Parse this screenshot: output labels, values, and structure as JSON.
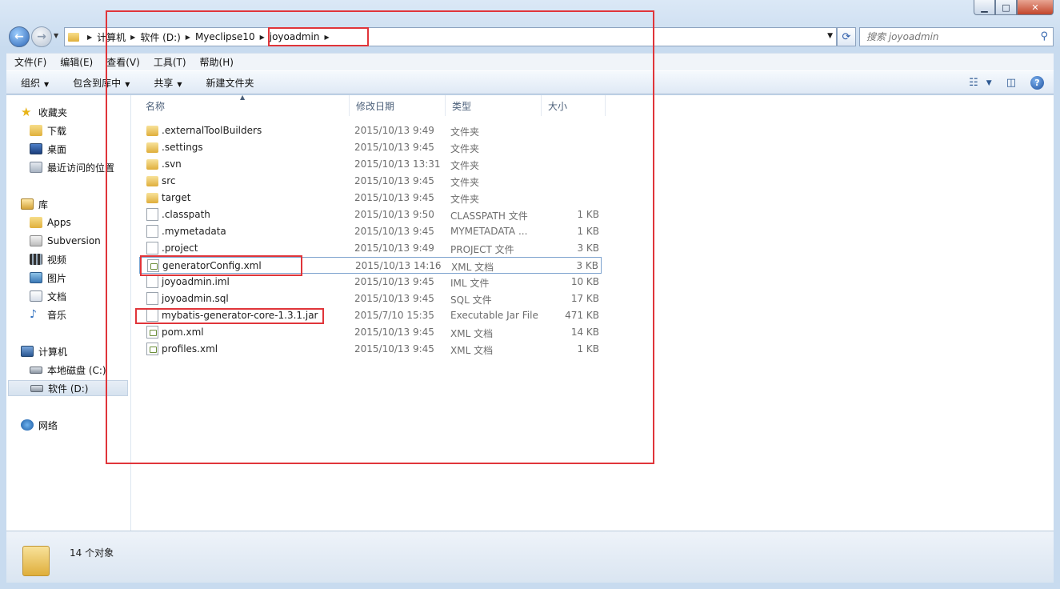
{
  "window": {
    "caption_buttons": [
      "minimize-icon",
      "maximize-icon",
      "close-icon"
    ]
  },
  "address": {
    "breadcrumbs": [
      "计算机",
      "软件 (D:)",
      "Myeclipse10",
      "joyoadmin"
    ]
  },
  "search": {
    "placeholder": "搜索 joyoadmin"
  },
  "menu": {
    "items": [
      "文件(F)",
      "编辑(E)",
      "查看(V)",
      "工具(T)",
      "帮助(H)"
    ]
  },
  "toolbar": {
    "organize": "组织",
    "include_in_library": "包含到库中",
    "share": "共享",
    "new_folder": "新建文件夹"
  },
  "sidebar": {
    "favorites": {
      "title": "收藏夹",
      "items": [
        "下载",
        "桌面",
        "最近访问的位置"
      ]
    },
    "libraries": {
      "title": "库",
      "items": [
        "Apps",
        "Subversion",
        "视频",
        "图片",
        "文档",
        "音乐"
      ]
    },
    "computer": {
      "title": "计算机",
      "items": [
        "本地磁盘 (C:)",
        "软件 (D:)"
      ]
    },
    "network": {
      "title": "网络"
    }
  },
  "columns": [
    "名称",
    "修改日期",
    "类型",
    "大小"
  ],
  "files": [
    {
      "name": ".externalToolBuilders",
      "date": "2015/10/13 9:49",
      "type": "文件夹",
      "size": "",
      "icon": "folder-icon"
    },
    {
      "name": ".settings",
      "date": "2015/10/13 9:45",
      "type": "文件夹",
      "size": "",
      "icon": "folder-icon"
    },
    {
      "name": ".svn",
      "date": "2015/10/13 13:31",
      "type": "文件夹",
      "size": "",
      "icon": "folder-icon"
    },
    {
      "name": "src",
      "date": "2015/10/13 9:45",
      "type": "文件夹",
      "size": "",
      "icon": "folder-icon"
    },
    {
      "name": "target",
      "date": "2015/10/13 9:45",
      "type": "文件夹",
      "size": "",
      "icon": "folder-icon"
    },
    {
      "name": ".classpath",
      "date": "2015/10/13 9:50",
      "type": "CLASSPATH 文件",
      "size": "1 KB",
      "icon": "file-icon"
    },
    {
      "name": ".mymetadata",
      "date": "2015/10/13 9:45",
      "type": "MYMETADATA ...",
      "size": "1 KB",
      "icon": "file-icon"
    },
    {
      "name": ".project",
      "date": "2015/10/13 9:49",
      "type": "PROJECT 文件",
      "size": "3 KB",
      "icon": "file-icon"
    },
    {
      "name": "generatorConfig.xml",
      "date": "2015/10/13 14:16",
      "type": "XML 文档",
      "size": "3 KB",
      "icon": "xml-file-icon"
    },
    {
      "name": "joyoadmin.iml",
      "date": "2015/10/13 9:45",
      "type": "IML 文件",
      "size": "10 KB",
      "icon": "file-icon"
    },
    {
      "name": "joyoadmin.sql",
      "date": "2015/10/13 9:45",
      "type": "SQL 文件",
      "size": "17 KB",
      "icon": "file-icon"
    },
    {
      "name": "mybatis-generator-core-1.3.1.jar",
      "date": "2015/7/10 15:35",
      "type": "Executable Jar File",
      "size": "471 KB",
      "icon": "file-icon"
    },
    {
      "name": "pom.xml",
      "date": "2015/10/13 9:45",
      "type": "XML 文档",
      "size": "14 KB",
      "icon": "xml-file-icon"
    },
    {
      "name": "profiles.xml",
      "date": "2015/10/13 9:45",
      "type": "XML 文档",
      "size": "1 KB",
      "icon": "xml-file-icon"
    }
  ],
  "status": {
    "count_text": "14 个对象"
  },
  "colors": {
    "annotation_red": "#e0353a",
    "selection_border": "#7da2ce"
  }
}
